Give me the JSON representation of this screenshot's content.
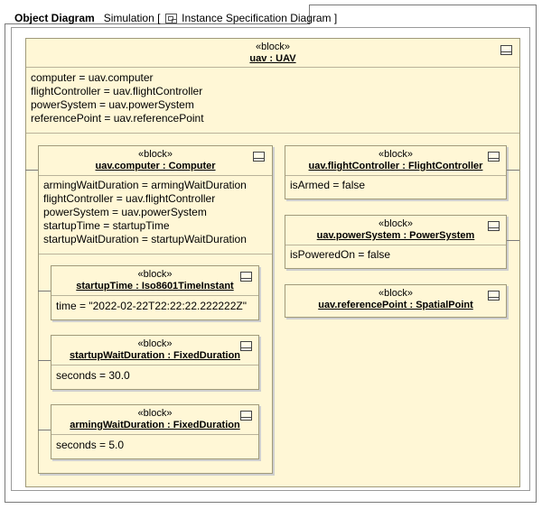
{
  "tab": {
    "kind": "Object Diagram",
    "name": "Simulation",
    "open": "[",
    "type": "Instance Specification Diagram",
    "close": "]"
  },
  "blocks": {
    "uav": {
      "stereotype": "«block»",
      "name": "uav : UAV",
      "slots": [
        "computer = uav.computer",
        "flightController = uav.flightController",
        "powerSystem = uav.powerSystem",
        "referencePoint = uav.referencePoint"
      ]
    },
    "computer": {
      "stereotype": "«block»",
      "name": "uav.computer : Computer",
      "slots": [
        "armingWaitDuration = armingWaitDuration",
        "flightController = uav.flightController",
        "powerSystem = uav.powerSystem",
        "startupTime = startupTime",
        "startupWaitDuration = startupWaitDuration"
      ]
    },
    "startupTime": {
      "stereotype": "«block»",
      "name": "startupTime : Iso8601TimeInstant",
      "slots": [
        "time = \"2022-02-22T22:22:22.222222Z\""
      ]
    },
    "startupWaitDuration": {
      "stereotype": "«block»",
      "name": "startupWaitDuration : FixedDuration",
      "slots": [
        "seconds = 30.0"
      ]
    },
    "armingWaitDuration": {
      "stereotype": "«block»",
      "name": "armingWaitDuration : FixedDuration",
      "slots": [
        "seconds = 5.0"
      ]
    },
    "flightController": {
      "stereotype": "«block»",
      "name": "uav.flightController : FlightController",
      "slots": [
        "isArmed = false"
      ]
    },
    "powerSystem": {
      "stereotype": "«block»",
      "name": "uav.powerSystem : PowerSystem",
      "slots": [
        "isPoweredOn = false"
      ]
    },
    "referencePoint": {
      "stereotype": "«block»",
      "name": "uav.referencePoint : SpatialPoint",
      "slots": []
    }
  }
}
